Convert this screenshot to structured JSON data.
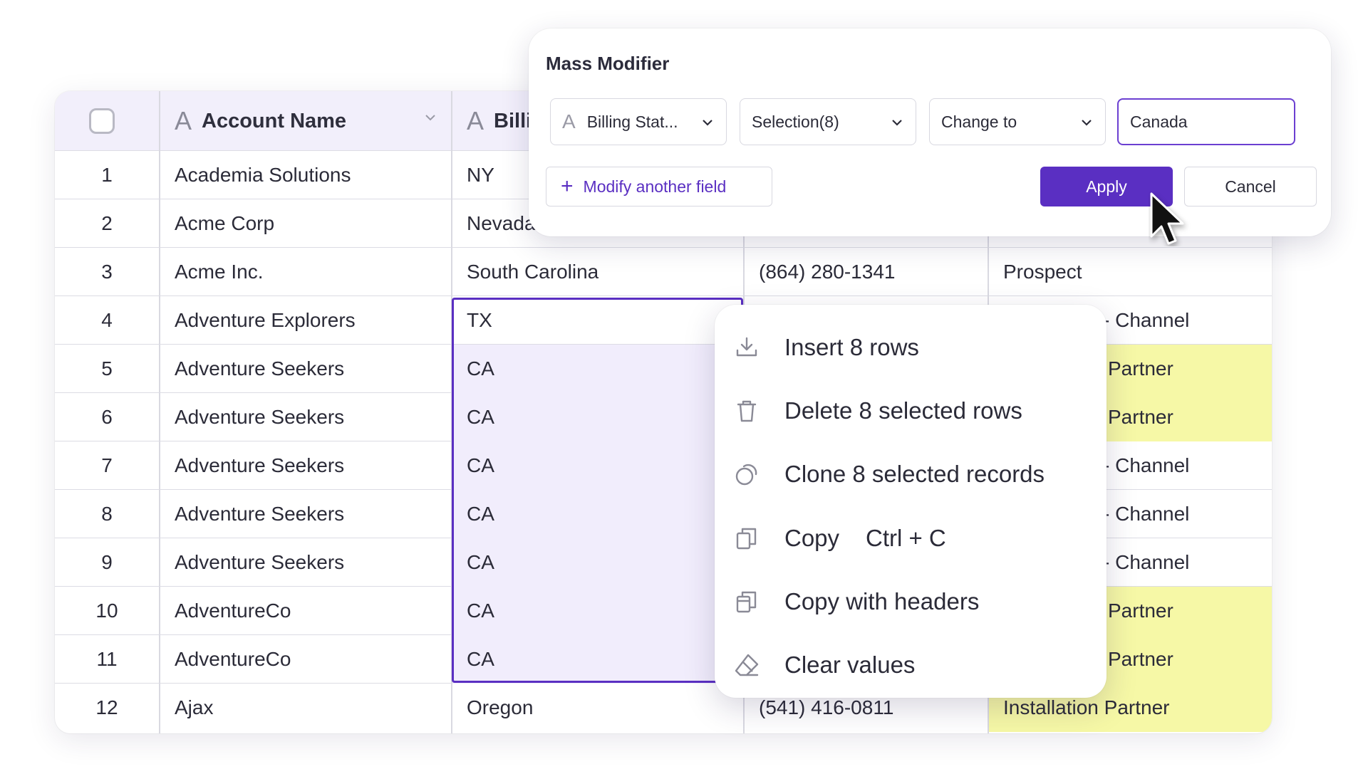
{
  "colors": {
    "accent": "#5a2fc2",
    "selection": "#f1edfc",
    "highlight_yellow": "#f6f8a6",
    "header_bg": "#f2effb"
  },
  "grid": {
    "columns": [
      {
        "label": "",
        "icon": "checkbox"
      },
      {
        "label": "Account Name",
        "icon": "text-type-icon"
      },
      {
        "label": "Billi",
        "icon": "text-type-icon"
      },
      {
        "label": "",
        "icon": ""
      },
      {
        "label": "",
        "icon": ""
      }
    ],
    "rows": [
      {
        "num": "1",
        "account": "Academia Solutions",
        "billing": "NY",
        "phone": "",
        "type": ""
      },
      {
        "num": "2",
        "account": "Acme Corp",
        "billing": "Nevada",
        "phone": "",
        "type": ""
      },
      {
        "num": "3",
        "account": "Acme Inc.",
        "billing": "South Carolina",
        "phone": "(864) 280-1341",
        "type": "Prospect"
      },
      {
        "num": "4",
        "account": "Adventure Explorers",
        "billing": "TX",
        "phone": "",
        "type": "- Channel"
      },
      {
        "num": "5",
        "account": "Adventure Seekers",
        "billing": "CA",
        "phone": "",
        "type": "Partner"
      },
      {
        "num": "6",
        "account": "Adventure Seekers",
        "billing": "CA",
        "phone": "",
        "type": "Partner"
      },
      {
        "num": "7",
        "account": "Adventure Seekers",
        "billing": "CA",
        "phone": "",
        "type": "- Channel"
      },
      {
        "num": "8",
        "account": "Adventure Seekers",
        "billing": "CA",
        "phone": "",
        "type": "- Channel"
      },
      {
        "num": "9",
        "account": "Adventure Seekers",
        "billing": "CA",
        "phone": "",
        "type": "- Channel"
      },
      {
        "num": "10",
        "account": "AdventureCo",
        "billing": "CA",
        "phone": "",
        "type": "Partner"
      },
      {
        "num": "11",
        "account": "AdventureCo",
        "billing": "CA",
        "phone": "",
        "type": "Partner"
      },
      {
        "num": "12",
        "account": "Ajax",
        "billing": "Oregon",
        "phone": "(541) 416-0811",
        "type": "Installation Partner"
      }
    ]
  },
  "mass_modifier": {
    "title": "Mass Modifier",
    "field_select": "Billing Stat...",
    "scope_select": "Selection(8)",
    "operation_select": "Change to",
    "value_input": "Canada",
    "modify_another": "Modify another field",
    "apply": "Apply",
    "cancel": "Cancel"
  },
  "context_menu": {
    "items": [
      {
        "label": "Insert 8 rows",
        "icon": "download-icon"
      },
      {
        "label": "Delete 8 selected rows",
        "icon": "trash-icon"
      },
      {
        "label": "Clone 8 selected records",
        "icon": "clone-icon"
      },
      {
        "label": "Copy",
        "shortcut": "Ctrl + C",
        "icon": "copy-icon"
      },
      {
        "label": "Copy with headers",
        "icon": "copy-headers-icon"
      },
      {
        "label": "Clear values",
        "icon": "eraser-icon"
      }
    ]
  }
}
